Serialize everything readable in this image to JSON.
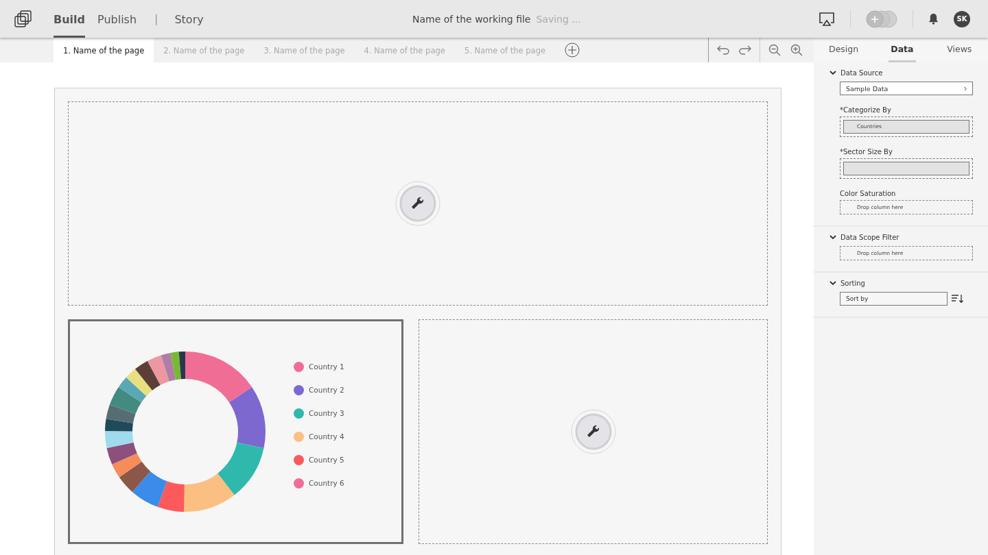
{
  "header": {
    "nav": [
      {
        "kind": "tab",
        "label": "Build",
        "selected": true
      },
      {
        "kind": "tab",
        "label": "Publish",
        "selected": false
      },
      {
        "kind": "divider",
        "label": "|"
      },
      {
        "kind": "tab",
        "label": "Story",
        "selected": false
      }
    ],
    "file_name": "Name of the working file",
    "save_status": "Saving ...",
    "avatar": "SK"
  },
  "page_tabs": [
    {
      "label": "1. Name of the page",
      "selected": true
    },
    {
      "label": "2. Name of the page",
      "selected": false
    },
    {
      "label": "3. Name of the page",
      "selected": false
    },
    {
      "label": "4. Name of the page",
      "selected": false
    },
    {
      "label": "5. Name of the page",
      "selected": false
    }
  ],
  "panel_tabs": [
    {
      "label": "Design",
      "selected": false
    },
    {
      "label": "Data",
      "selected": true
    },
    {
      "label": "Views",
      "selected": false
    }
  ],
  "sections": [
    {
      "title": "Data Source",
      "expanded": true,
      "fields": [
        {
          "kind": "select",
          "value": "Sample Data"
        },
        {
          "kind": "slot",
          "label": "*Categorize By",
          "value": "Countries"
        },
        {
          "kind": "slot",
          "label": "*Sector Size By"
        },
        {
          "kind": "drop",
          "label": "Color Saturation",
          "placeholder": "Drop column here"
        }
      ]
    },
    {
      "title": "Data Scope Filter",
      "expanded": true,
      "fields": [
        {
          "kind": "drop",
          "placeholder": "Drop column here"
        }
      ]
    },
    {
      "title": "Sorting",
      "expanded": true,
      "fields": [
        {
          "kind": "sort",
          "placeholder": "Sort by"
        }
      ]
    }
  ],
  "legend": [
    {
      "label": "Country 1",
      "color": "#f06e96"
    },
    {
      "label": "Country 2",
      "color": "#7d68d0"
    },
    {
      "label": "Country 3",
      "color": "#2fb9ad"
    },
    {
      "label": "Country 4",
      "color": "#fbc081"
    },
    {
      "label": "Country 5",
      "color": "#fb5a5c"
    },
    {
      "label": "Country 6",
      "color": "#f06e96"
    }
  ]
}
